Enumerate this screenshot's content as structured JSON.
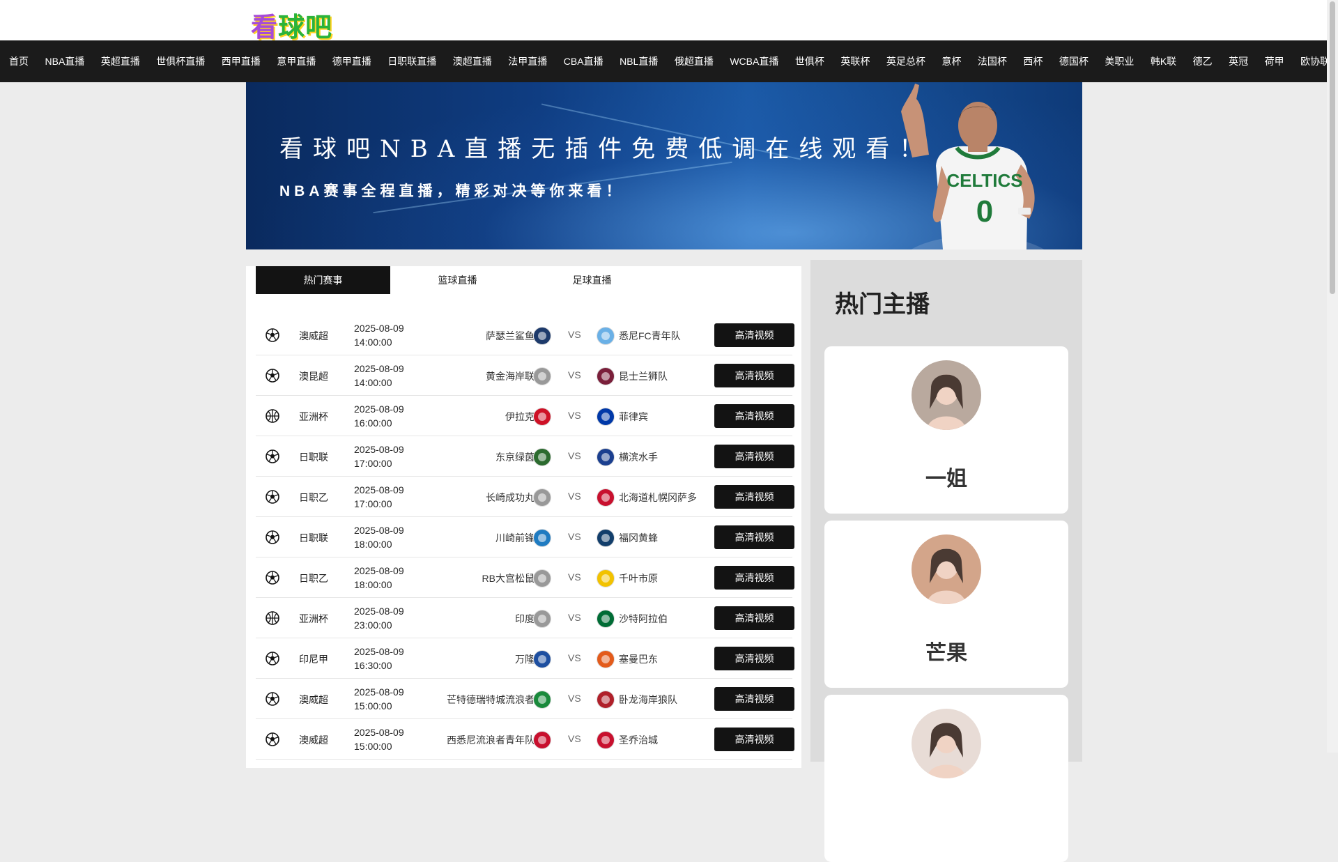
{
  "logo": {
    "chars": [
      "看",
      "球",
      "吧"
    ]
  },
  "nav": [
    "首页",
    "NBA直播",
    "英超直播",
    "世俱杯直播",
    "西甲直播",
    "意甲直播",
    "德甲直播",
    "日职联直播",
    "澳超直播",
    "法甲直播",
    "CBA直播",
    "NBL直播",
    "俄超直播",
    "WCBA直播",
    "世俱杯",
    "英联杯",
    "英足总杯",
    "意杯",
    "法国杯",
    "西杯",
    "德国杯",
    "美职业",
    "韩K联",
    "德乙",
    "英冠",
    "荷甲",
    "欧协联"
  ],
  "banner": {
    "title": "看球吧NBA直播无插件免费低调在线观看！",
    "subtitle": "NBA赛事全程直播，精彩对决等你来看！"
  },
  "tabs": [
    "热门赛事",
    "篮球直播",
    "足球直播"
  ],
  "matches": [
    {
      "sport": "soccer-ball-icon",
      "league": "澳威超",
      "date": "2025-08-09",
      "time": "14:00:00",
      "home": "萨瑟兰鲨鱼",
      "away": "悉尼FC青年队",
      "btn": "高清视频",
      "hcolor": "#1d3a6b",
      "acolor": "#6ab0e6"
    },
    {
      "sport": "soccer-ball-icon",
      "league": "澳昆超",
      "date": "2025-08-09",
      "time": "14:00:00",
      "home": "黄金海岸联",
      "away": "昆士兰狮队",
      "btn": "高清视频",
      "hcolor": "#999999",
      "acolor": "#7a1f3a"
    },
    {
      "sport": "basketball-icon",
      "league": "亚洲杯",
      "date": "2025-08-09",
      "time": "16:00:00",
      "home": "伊拉克",
      "away": "菲律宾",
      "btn": "高清视频",
      "hcolor": "#ce1126",
      "acolor": "#0038a8"
    },
    {
      "sport": "soccer-ball-icon",
      "league": "日职联",
      "date": "2025-08-09",
      "time": "17:00:00",
      "home": "东京绿茵",
      "away": "横滨水手",
      "btn": "高清视频",
      "hcolor": "#2c6b2f",
      "acolor": "#1b3f8f"
    },
    {
      "sport": "soccer-ball-icon",
      "league": "日职乙",
      "date": "2025-08-09",
      "time": "17:00:00",
      "home": "长崎成功丸",
      "away": "北海道札幌冈萨多",
      "btn": "高清视频",
      "hcolor": "#999999",
      "acolor": "#c8102e"
    },
    {
      "sport": "soccer-ball-icon",
      "league": "日职联",
      "date": "2025-08-09",
      "time": "18:00:00",
      "home": "川崎前锋",
      "away": "福冈黄蜂",
      "btn": "高清视频",
      "hcolor": "#1f7bc1",
      "acolor": "#123e6b"
    },
    {
      "sport": "soccer-ball-icon",
      "league": "日职乙",
      "date": "2025-08-09",
      "time": "18:00:00",
      "home": "RB大宫松鼠",
      "away": "千叶市原",
      "btn": "高清视频",
      "hcolor": "#999999",
      "acolor": "#f2c200"
    },
    {
      "sport": "basketball-icon",
      "league": "亚洲杯",
      "date": "2025-08-09",
      "time": "23:00:00",
      "home": "印度",
      "away": "沙特阿拉伯",
      "btn": "高清视频",
      "hcolor": "#999999",
      "acolor": "#006c35"
    },
    {
      "sport": "soccer-ball-icon",
      "league": "印尼甲",
      "date": "2025-08-09",
      "time": "16:30:00",
      "home": "万隆",
      "away": "塞曼巴东",
      "btn": "高清视频",
      "hcolor": "#1e4fa0",
      "acolor": "#e35b1b"
    },
    {
      "sport": "soccer-ball-icon",
      "league": "澳威超",
      "date": "2025-08-09",
      "time": "15:00:00",
      "home": "芒特德瑞特城流浪者",
      "away": "卧龙海岸狼队",
      "btn": "高清视频",
      "hcolor": "#1a8a3c",
      "acolor": "#b0202a"
    },
    {
      "sport": "soccer-ball-icon",
      "league": "澳威超",
      "date": "2025-08-09",
      "time": "15:00:00",
      "home": "西悉尼流浪者青年队",
      "away": "圣乔治城",
      "btn": "高清视频",
      "hcolor": "#c8102e",
      "acolor": "#c8102e"
    }
  ],
  "sidebar": {
    "title": "热门主播",
    "streamers": [
      {
        "name": "一姐",
        "tone": "#b9a99e"
      },
      {
        "name": "芒果",
        "tone": "#d3a58a"
      },
      {
        "name": "",
        "tone": "#e8dcd6"
      }
    ]
  }
}
